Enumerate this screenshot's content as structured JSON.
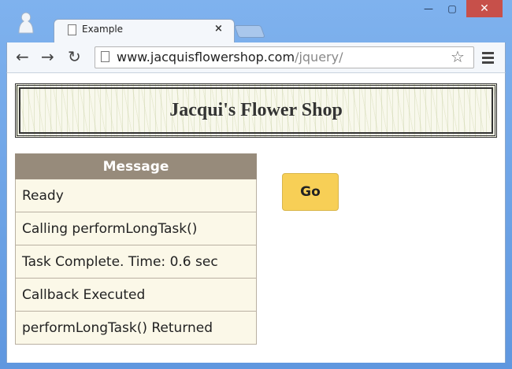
{
  "window": {
    "minimize_glyph": "—",
    "maximize_glyph": "▢",
    "close_glyph": "✕"
  },
  "tab": {
    "title": "Example",
    "close_glyph": "×"
  },
  "toolbar": {
    "back_glyph": "←",
    "forward_glyph": "→",
    "reload_glyph": "↻",
    "url_host": "www.jacquisflowershop.com",
    "url_path": "/jquery/",
    "star_glyph": "☆"
  },
  "page": {
    "banner_title": "Jacqui's Flower Shop",
    "table": {
      "header": "Message",
      "rows": [
        "Ready",
        "Calling performLongTask()",
        "Task Complete. Time: 0.6 sec",
        "Callback Executed",
        "performLongTask() Returned"
      ]
    },
    "go_button": "Go"
  },
  "colors": {
    "frame": "#6fa3e6",
    "table_header": "#978b7b",
    "table_cell": "#fbf8e8",
    "go_button": "#f7cf56"
  }
}
